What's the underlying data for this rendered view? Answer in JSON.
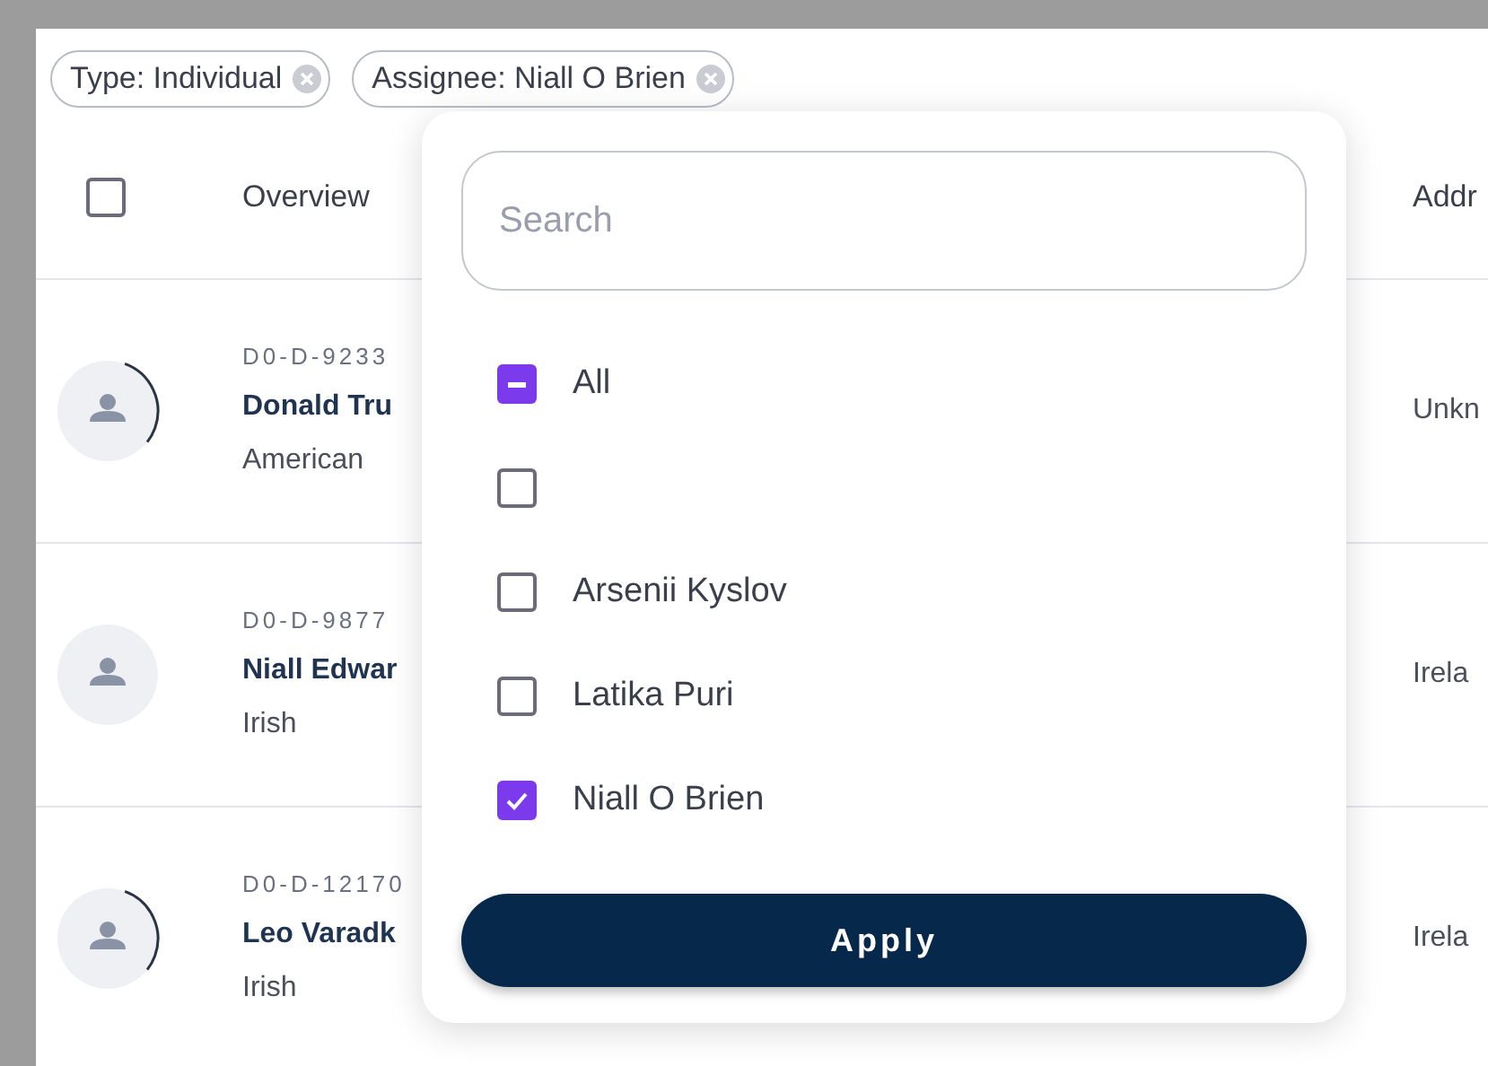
{
  "filter_chips": [
    {
      "label": "Type: Individual"
    },
    {
      "label": "Assignee: Niall O Brien"
    }
  ],
  "table": {
    "select_all": {
      "checked": false
    },
    "columns": [
      "Overview",
      "Addr"
    ],
    "rows": [
      {
        "id": "D0-D-9233",
        "name": "Donald Tru",
        "nationality": "American",
        "address": "Unkn",
        "loading": true
      },
      {
        "id": "D0-D-9877",
        "name": "Niall Edwar",
        "nationality": "Irish",
        "address": "Irela",
        "loading": false
      },
      {
        "id": "D0-D-12170",
        "name": "Leo Varadk",
        "nationality": "Irish",
        "address": "Irela",
        "loading": true
      }
    ]
  },
  "dropdown": {
    "search": {
      "placeholder": "Search"
    },
    "options": [
      {
        "label": "All",
        "indeterminate": true
      },
      {
        "checked": false
      },
      {
        "label": "Arsenii Kyslov",
        "checked": false
      },
      {
        "label": "Latika Puri",
        "checked": false
      },
      {
        "label": "Niall O Brien",
        "checked": true
      }
    ],
    "apply_button": "Apply"
  }
}
